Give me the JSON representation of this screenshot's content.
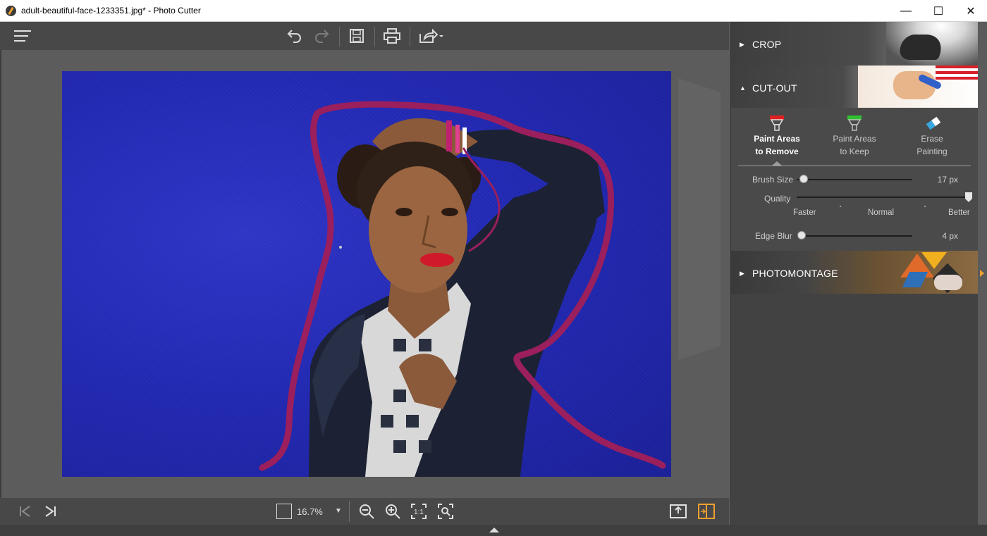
{
  "window": {
    "title": "adult-beautiful-face-1233351.jpg* - Photo Cutter",
    "minimize_glyph": "—",
    "maximize_glyph": "☐",
    "close_glyph": "✕"
  },
  "toolbar": {
    "icons": [
      "menu-icon",
      "undo-icon",
      "redo-icon",
      "save-icon",
      "print-icon",
      "share-icon"
    ]
  },
  "bottom_bar": {
    "zoom_value": "16.7%",
    "zoom_dropdown_glyph": "▼",
    "icons": [
      "first-image-icon",
      "last-image-icon",
      "zoom-out-icon",
      "zoom-in-icon",
      "actual-size-icon",
      "fit-to-window-icon",
      "export-icon",
      "compare-view-icon"
    ]
  },
  "panel": {
    "crop": {
      "label": "CROP",
      "collapsed": true
    },
    "cutout": {
      "label": "CUT-OUT",
      "collapsed": false,
      "modes": [
        {
          "line1": "Paint Areas",
          "line2": "to Remove",
          "active": true,
          "color": "#e02020"
        },
        {
          "line1": "Paint Areas",
          "line2": "to Keep",
          "active": false,
          "color": "#30c030"
        },
        {
          "line1": "Erase",
          "line2": "Painting",
          "active": false,
          "color": "#3aa8e0"
        }
      ],
      "brush_size": {
        "label": "Brush Size",
        "value": "17 px",
        "fraction": 0.06
      },
      "quality": {
        "label": "Quality",
        "scale_labels": [
          "Faster",
          "Normal",
          "Better"
        ],
        "fraction": 1.0
      },
      "edge_blur": {
        "label": "Edge Blur",
        "value": "4 px",
        "fraction": 0.04
      }
    },
    "photomontage": {
      "label": "PHOTOMONTAGE",
      "collapsed": true
    }
  },
  "colors": {
    "accent": "#f0a030",
    "stroke": "#9a1f5c",
    "background_wall": "#2229b5"
  }
}
